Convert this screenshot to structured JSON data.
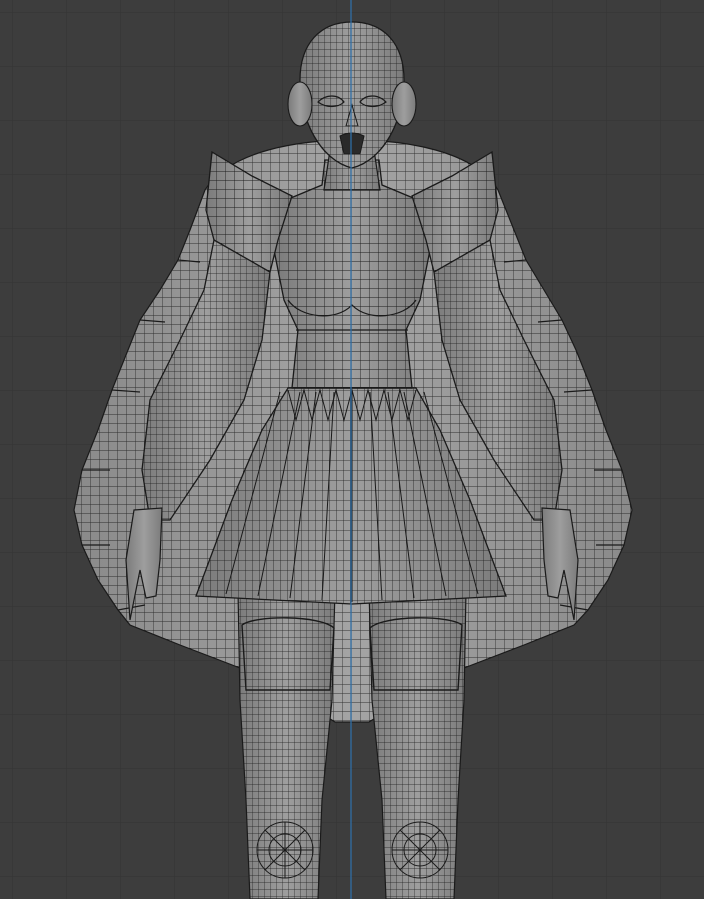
{
  "viewport": {
    "view": "front-orthographic",
    "shading": "solid",
    "overlay": "wireframe",
    "background_color": "#3d3d3d",
    "grid_color": "#333333",
    "axis_color": "#2f6fa8",
    "mesh_color": "#8f8f8f",
    "wire_color": "#1c1c1c"
  }
}
